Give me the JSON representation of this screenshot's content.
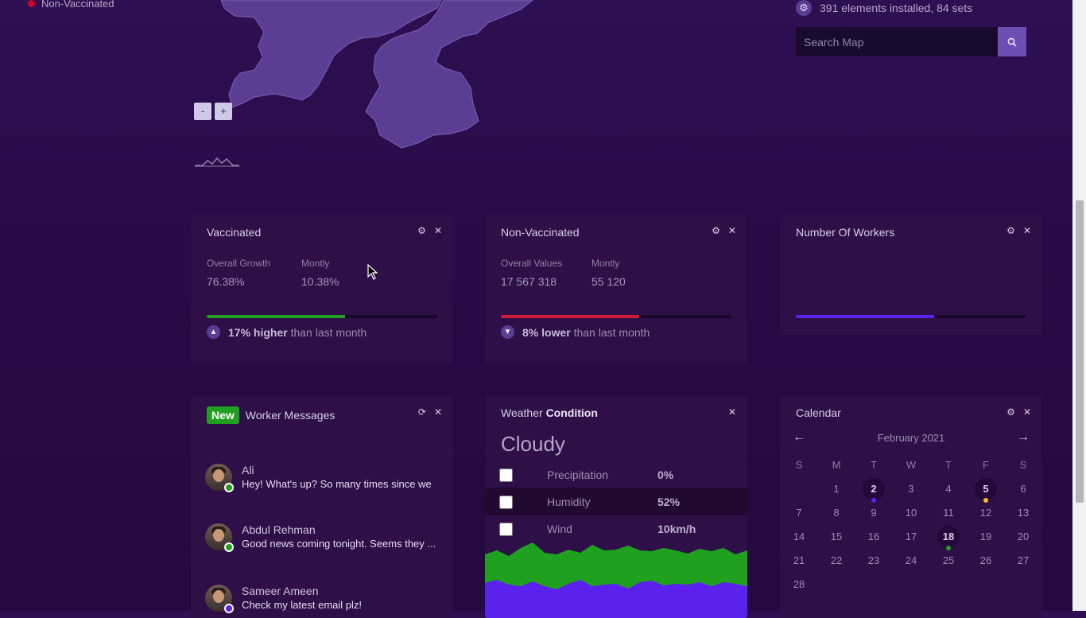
{
  "legend": {
    "non_vaccinated": "Non-Vaccinated",
    "color": "#d2002a"
  },
  "map": {
    "zoom_out": "-",
    "zoom_in": "+",
    "fill": "#5a3e93"
  },
  "installed": {
    "icon": "gear-icon",
    "text": "391 elements installed, 84 sets"
  },
  "search": {
    "placeholder": "Search Map",
    "icon": "search-icon"
  },
  "cards": {
    "vaccinated": {
      "title": "Vaccinated",
      "stat1_label": "Overall Growth",
      "stat1_value": "76.38%",
      "stat2_label": "Montly",
      "stat2_value": "10.38%",
      "progress": 0.6,
      "bar_color": "#1fa11f",
      "trend_bold": "17% higher",
      "trend_text": "than last month",
      "trend_icon": "chevron-up-icon"
    },
    "non_vaccinated": {
      "title": "Non-Vaccinated",
      "stat1_label": "Overall Values",
      "stat1_value": "17 567 318",
      "stat2_label": "Montly",
      "stat2_value": "55 120",
      "progress": 0.6,
      "bar_color": "#d01b3c",
      "trend_bold": "8% lower",
      "trend_text": "than last month",
      "trend_icon": "chevron-down-icon"
    },
    "workers": {
      "title": "Number Of Workers",
      "progress": 0.6,
      "bar_color": "#5b22ee"
    },
    "messages": {
      "badge": "New",
      "title": "Worker Messages",
      "items": [
        {
          "name": "Ali",
          "text": "Hey! What's up? So many times since we",
          "status_color": "#1fa11f"
        },
        {
          "name": "Abdul Rehman",
          "text": "Good news coming tonight. Seems they ...",
          "status_color": "#1fa11f"
        },
        {
          "name": "Sameer Ameen",
          "text": "Check my latest email plz!",
          "status_color": "#5b22ee"
        }
      ]
    },
    "weather": {
      "title_light": "Weather",
      "title_bold": "Condition",
      "condition": "Cloudy",
      "rows": [
        {
          "label": "Precipitation",
          "value": "0%"
        },
        {
          "label": "Humidity",
          "value": "52%"
        },
        {
          "label": "Wind",
          "value": "10km/h"
        }
      ],
      "colors": {
        "top": "#1fa11f",
        "bottom": "#5b22ee"
      }
    },
    "calendar": {
      "title": "Calendar",
      "month": "February 2021",
      "prev_icon": "arrow-left-icon",
      "next_icon": "arrow-right-icon",
      "dow": [
        "S",
        "M",
        "T",
        "W",
        "T",
        "F",
        "S"
      ],
      "first_weekday": 1,
      "days_in_month": 28,
      "marked": [
        {
          "day": 2,
          "dot": "#5b22ee"
        },
        {
          "day": 5,
          "dot": "#f5c518"
        },
        {
          "day": 18,
          "dot": "#1fa11f"
        }
      ]
    }
  }
}
